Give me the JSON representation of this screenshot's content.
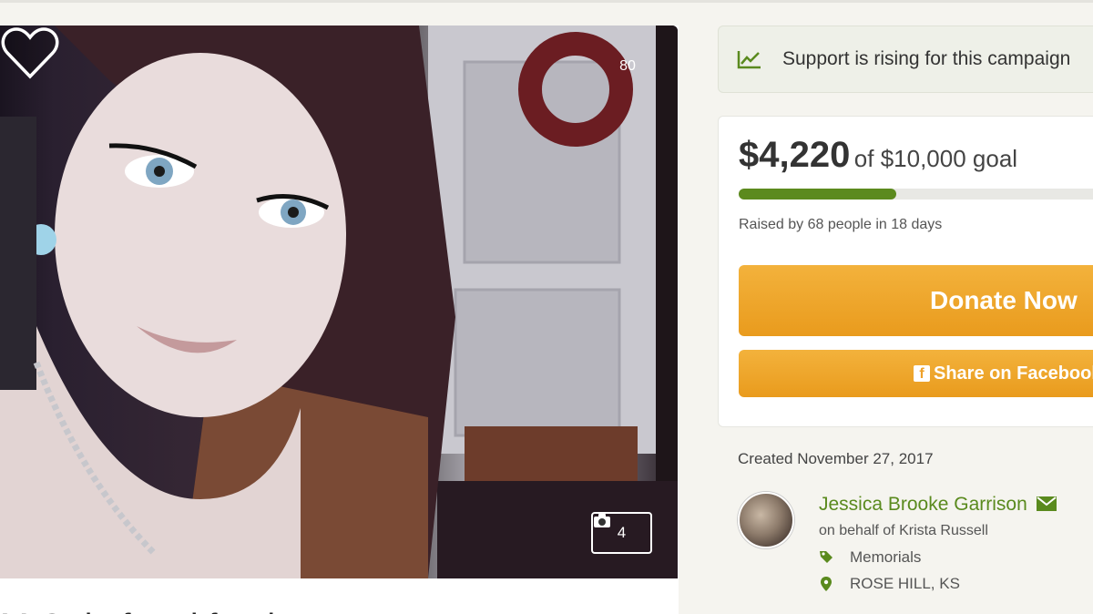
{
  "photo": {
    "like_count": "80",
    "photo_count": "4"
  },
  "campaign": {
    "title_partial": "M  Quitt  f  n  r  l  f  n  d"
  },
  "trend": {
    "text": "Support is rising for this campaign",
    "icon": "line-chart-icon"
  },
  "donation": {
    "raised": "$4,220",
    "goal_text": "of $10,000 goal",
    "progress_fraction": 0.422,
    "raised_by": "Raised by 68 people in 18 days",
    "donate_label": "Donate Now",
    "share_label": "Share on Facebook"
  },
  "organizer": {
    "created": "Created November 27, 2017",
    "name": "Jessica Brooke Garrison",
    "on_behalf": "on behalf of Krista Russell",
    "category": "Memorials",
    "location": "ROSE HILL, KS"
  },
  "colors": {
    "accent_green": "#5a8a1e",
    "button_orange": "#eea12a"
  }
}
